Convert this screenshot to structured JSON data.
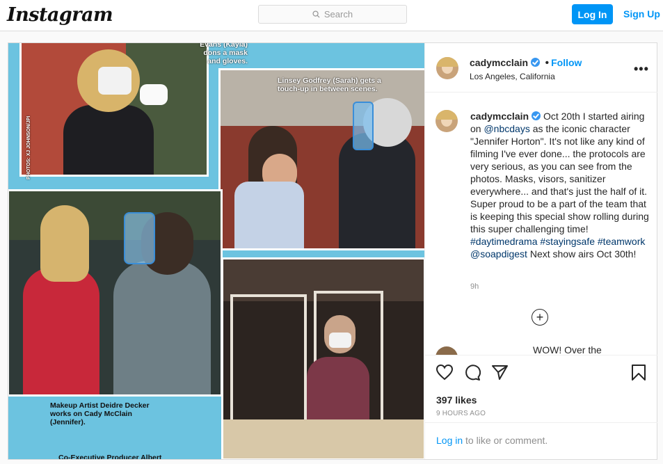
{
  "nav": {
    "brand": "Instagram",
    "search_placeholder": "Search",
    "login_label": "Log In",
    "signup_label": "Sign Up"
  },
  "post": {
    "username": "cadymcclain",
    "follow_label": "Follow",
    "location": "Los Angeles, California",
    "caption_segments": [
      {
        "text": "Oct 20th I started airing on ",
        "link": false
      },
      {
        "text": "@nbcdays",
        "link": true
      },
      {
        "text": " as the iconic character \"Jennifer Horton\". It's not like any kind of filming I've ever done... the protocols are very serious, as you can see from the photos. Masks, visors, sanitizer everywhere... and that's just the half of it. Super proud to be a part of the team that is keeping this special show rolling during this super challenging time! ",
        "link": false
      },
      {
        "text": "#daytimedrama",
        "link": true
      },
      {
        "text": " ",
        "link": false
      },
      {
        "text": "#stayingsafe",
        "link": true
      },
      {
        "text": " ",
        "link": false
      },
      {
        "text": "#teamwork",
        "link": true
      },
      {
        "text": " ",
        "link": false
      },
      {
        "text": "@soapdigest",
        "link": true
      },
      {
        "text": " Next show airs Oct 30th!",
        "link": false
      }
    ],
    "caption_age": "9h",
    "peek_comment": "WOW! Over the",
    "likes": "397 likes",
    "posted_ago": "9 HOURS AGO",
    "login_link": "Log in",
    "login_suffix": " to like or comment."
  },
  "media": {
    "captions": {
      "top_left": "Evans (Kayla)\ndons a mask\nand gloves.",
      "top_right": "Linsey Godfrey (Sarah) gets a\ntouch-up in between scenes.",
      "photo_credit": "PHOTOS: XJ JOHNSON/JPI",
      "bottom_left": "Makeup Artist Deidre Decker\nworks on Cady McClain\n(Jennifer).",
      "bottom_cut": "Co-Executive Producer Albert"
    }
  },
  "colors": {
    "accent": "#0095f6",
    "link": "#00376b",
    "page_bg": "#fafafa",
    "border": "#dbdbdb",
    "magazine_bg": "#6cc3e0"
  }
}
